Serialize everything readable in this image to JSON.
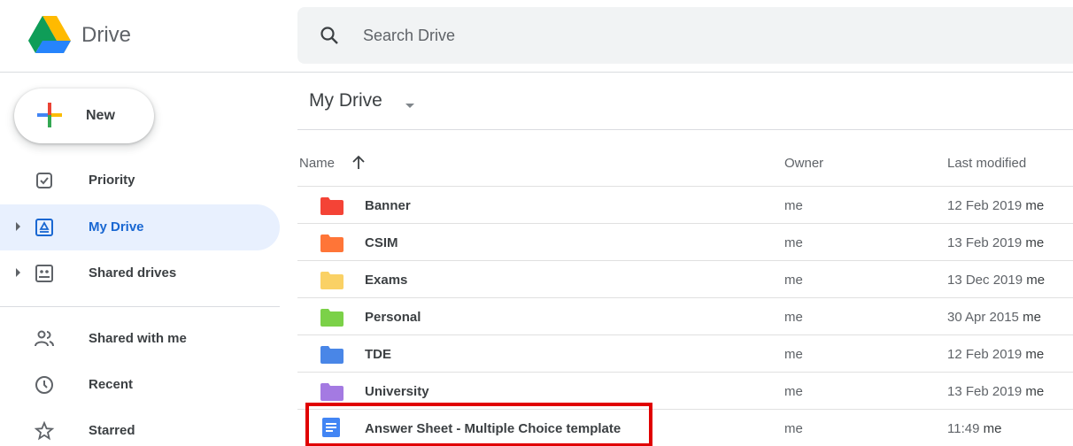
{
  "app": {
    "brand": "Drive"
  },
  "search": {
    "placeholder": "Search Drive"
  },
  "new_button": {
    "label": "New"
  },
  "sidebar": {
    "items": [
      {
        "label": "Priority",
        "icon": "priority-icon"
      },
      {
        "label": "My Drive",
        "icon": "my-drive-icon",
        "active": true
      },
      {
        "label": "Shared drives",
        "icon": "shared-drives-icon"
      },
      {
        "label": "Shared with me",
        "icon": "shared-with-me-icon"
      },
      {
        "label": "Recent",
        "icon": "clock-icon"
      },
      {
        "label": "Starred",
        "icon": "star-icon"
      }
    ]
  },
  "breadcrumb": {
    "title": "My Drive"
  },
  "table": {
    "columns": {
      "name": "Name",
      "owner": "Owner",
      "modified": "Last modified"
    },
    "rows": [
      {
        "name": "Banner",
        "owner": "me",
        "date": "12 Feb 2019",
        "modifier": "me",
        "type": "folder",
        "color": "#f44336"
      },
      {
        "name": "CSIM",
        "owner": "me",
        "date": "13 Feb 2019",
        "modifier": "me",
        "type": "folder",
        "color": "#ff7537"
      },
      {
        "name": "Exams",
        "owner": "me",
        "date": "13 Dec 2019",
        "modifier": "me",
        "type": "folder",
        "color": "#fad165"
      },
      {
        "name": "Personal",
        "owner": "me",
        "date": "30 Apr 2015",
        "modifier": "me",
        "type": "folder",
        "color": "#7bd148"
      },
      {
        "name": "TDE",
        "owner": "me",
        "date": "12 Feb 2019",
        "modifier": "me",
        "type": "folder",
        "color": "#4986e7"
      },
      {
        "name": "University",
        "owner": "me",
        "date": "13 Feb 2019",
        "modifier": "me",
        "type": "folder",
        "color": "#a47ae2"
      },
      {
        "name": "Answer Sheet - Multiple Choice template",
        "owner": "me",
        "date": "11:49",
        "modifier": "me",
        "type": "doc",
        "color": "#4285f4"
      }
    ]
  },
  "colors": {
    "accent": "#1967d2",
    "active_bg": "#e8f0fe",
    "highlight": "#e00000"
  }
}
